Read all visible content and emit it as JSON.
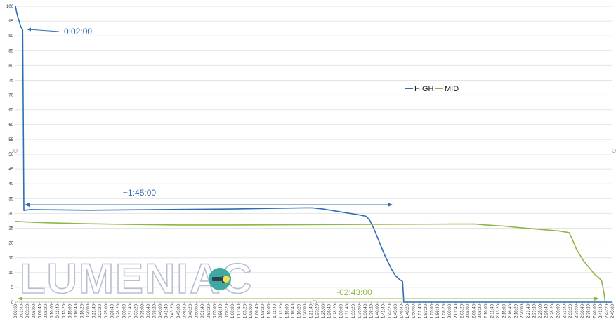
{
  "chart_data": {
    "type": "line",
    "ylim": [
      0,
      100
    ],
    "yticks": [
      0,
      5,
      10,
      15,
      20,
      25,
      30,
      35,
      40,
      45,
      50,
      55,
      60,
      65,
      70,
      75,
      80,
      85,
      90,
      95,
      100
    ],
    "xlim_minutes": [
      0,
      165
    ],
    "x_tick_step_minutes": 1.6667,
    "grid": "horizontal",
    "legend_position": "right-middle",
    "series": [
      {
        "name": "HIGH",
        "color": "#2e6db4",
        "points": [
          [
            "0:00:00",
            100
          ],
          [
            "0:00:30",
            97
          ],
          [
            "0:01:00",
            95
          ],
          [
            "0:01:30",
            93
          ],
          [
            "0:02:00",
            92
          ],
          [
            "0:02:10",
            60
          ],
          [
            "0:02:20",
            31
          ],
          [
            "0:04:00",
            31.3
          ],
          [
            "0:20:00",
            31.1
          ],
          [
            "0:40:00",
            31.3
          ],
          [
            "1:00:00",
            31.5
          ],
          [
            "1:10:00",
            31.7
          ],
          [
            "1:20:00",
            31.9
          ],
          [
            "1:22:00",
            31.9
          ],
          [
            "1:25:00",
            31.5
          ],
          [
            "1:30:00",
            30.5
          ],
          [
            "1:35:00",
            29.5
          ],
          [
            "1:37:00",
            29.0
          ],
          [
            "1:38:00",
            27.5
          ],
          [
            "1:39:00",
            25
          ],
          [
            "1:40:00",
            22
          ],
          [
            "1:41:00",
            19
          ],
          [
            "1:42:00",
            16
          ],
          [
            "1:43:00",
            13.5
          ],
          [
            "1:44:00",
            11
          ],
          [
            "1:45:00",
            9
          ],
          [
            "1:46:00",
            7.8
          ],
          [
            "1:47:00",
            7
          ],
          [
            "1:47:20",
            0
          ],
          [
            "2:45:00",
            0
          ]
        ]
      },
      {
        "name": "MID",
        "color": "#8db742",
        "points": [
          [
            "0:00:00",
            27.3
          ],
          [
            "0:05:00",
            27.0
          ],
          [
            "0:10:00",
            26.8
          ],
          [
            "0:20:00",
            26.5
          ],
          [
            "0:30:00",
            26.3
          ],
          [
            "0:45:00",
            26.1
          ],
          [
            "1:00:00",
            26.1
          ],
          [
            "1:20:00",
            26.2
          ],
          [
            "1:40:00",
            26.3
          ],
          [
            "2:00:00",
            26.4
          ],
          [
            "2:07:00",
            26.4
          ],
          [
            "2:10:00",
            26.1
          ],
          [
            "2:15:00",
            25.7
          ],
          [
            "2:20:00",
            25.1
          ],
          [
            "2:25:00",
            24.6
          ],
          [
            "2:30:00",
            24.1
          ],
          [
            "2:33:00",
            23.5
          ],
          [
            "2:34:00",
            21.0
          ],
          [
            "2:35:00",
            18.0
          ],
          [
            "2:36:00",
            16.0
          ],
          [
            "2:37:00",
            14.0
          ],
          [
            "2:38:00",
            12.5
          ],
          [
            "2:39:00",
            11.0
          ],
          [
            "2:40:00",
            9.5
          ],
          [
            "2:41:00",
            8.5
          ],
          [
            "2:42:00",
            7.3
          ],
          [
            "2:42:40",
            3
          ],
          [
            "2:43:00",
            0
          ]
        ]
      }
    ],
    "annotations": [
      {
        "text": "0:02:00",
        "color": "#2e6db4"
      },
      {
        "text": "~1:45:00",
        "color": "#2e6db4"
      },
      {
        "text": "~02:43:00",
        "color": "#8db742"
      }
    ]
  },
  "watermark": {
    "text": "LUMENIAC",
    "icon": "flashlight-icon"
  }
}
